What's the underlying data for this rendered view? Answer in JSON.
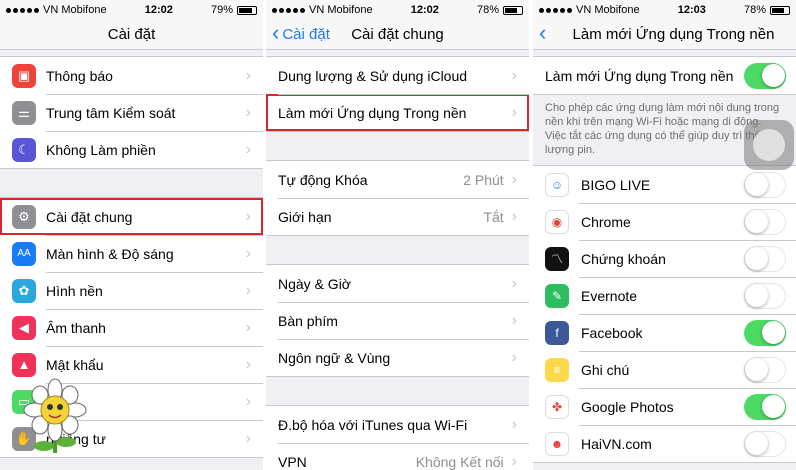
{
  "panels": [
    {
      "status": {
        "carrier": "VN Mobifone",
        "time": "12:02",
        "battery": "79%",
        "battery_level": 0.79
      },
      "nav": {
        "title": "Cài đặt"
      },
      "groups": [
        [
          {
            "label": "Thông báo",
            "icon": "notification-icon",
            "color": "#f0443a"
          },
          {
            "label": "Trung tâm Kiểm soát",
            "icon": "control-center-icon",
            "color": "#8e8e93"
          },
          {
            "label": "Không Làm phiền",
            "icon": "moon-icon",
            "color": "#5856d6"
          }
        ],
        [
          {
            "label": "Cài đặt chung",
            "icon": "gear-icon",
            "color": "#8e8e93"
          },
          {
            "label": "Màn hình & Độ sáng",
            "icon": "display-icon",
            "color": "#1a7cf5"
          },
          {
            "label": "Hình nền",
            "icon": "wallpaper-icon",
            "color": "#2aa7dc"
          },
          {
            "label": "Âm thanh",
            "icon": "sound-icon",
            "color": "#f0325a"
          },
          {
            "label": "Mật khẩu",
            "icon": "lock-icon",
            "color": "#f0325a"
          },
          {
            "label": "",
            "icon": "battery-icon",
            "color": "#4cd964"
          },
          {
            "label": "n riêng tư",
            "icon": "privacy-icon",
            "color": "#8e8e93"
          }
        ]
      ]
    },
    {
      "status": {
        "carrier": "VN Mobifone",
        "time": "12:02",
        "battery": "78%",
        "battery_level": 0.78
      },
      "nav": {
        "back": "Cài đặt",
        "title": "Cài đặt chung"
      },
      "groups": [
        [
          {
            "label": "Dung lượng & Sử dụng iCloud",
            "value": ""
          },
          {
            "label": "Làm mới Ứng dụng Trong nền",
            "value": ""
          }
        ],
        [
          {
            "label": "Tự động Khóa",
            "value": "2 Phút"
          },
          {
            "label": "Giới hạn",
            "value": "Tắt"
          }
        ],
        [
          {
            "label": "Ngày & Giờ",
            "value": ""
          },
          {
            "label": "Bàn phím",
            "value": ""
          },
          {
            "label": "Ngôn ngữ & Vùng",
            "value": ""
          }
        ],
        [
          {
            "label": "Đ.bộ hóa với iTunes qua Wi-Fi",
            "value": ""
          },
          {
            "label": "VPN",
            "value": "Không Kết nối"
          }
        ]
      ]
    },
    {
      "status": {
        "carrier": "VN Mobifone",
        "time": "12:03",
        "battery": "78%",
        "battery_level": 0.78
      },
      "nav": {
        "title": "Làm mới Ứng dụng Trong nền"
      },
      "master": {
        "label": "Làm mới Ứng dụng Trong nền",
        "on": true
      },
      "footer": "Cho phép các ứng dụng làm mới nội dung trong nền khi trên mạng Wi-Fi hoặc mạng di động. Việc tắt các ứng dụng có thể giúp duy trì thời lượng pin.",
      "apps": [
        {
          "label": "BIGO LIVE",
          "on": false,
          "icon": "bigo-live-icon",
          "color": "#ffffff",
          "glyph": "☺",
          "fg": "#1a8fd6"
        },
        {
          "label": "Chrome",
          "on": false,
          "icon": "chrome-icon",
          "color": "#ffffff",
          "glyph": "◉",
          "fg": "#db4437"
        },
        {
          "label": "Chứng khoán",
          "on": false,
          "icon": "stocks-icon",
          "color": "#111111",
          "glyph": "〽",
          "fg": "#ffffff"
        },
        {
          "label": "Evernote",
          "on": false,
          "icon": "evernote-icon",
          "color": "#2dbe60",
          "glyph": "✎",
          "fg": "#ffffff"
        },
        {
          "label": "Facebook",
          "on": true,
          "icon": "facebook-icon",
          "color": "#3b5998",
          "glyph": "f",
          "fg": "#ffffff"
        },
        {
          "label": "Ghi chú",
          "on": false,
          "icon": "notes-icon",
          "color": "#fcd84b",
          "glyph": "≡",
          "fg": "#ffffff"
        },
        {
          "label": "Google Photos",
          "on": true,
          "icon": "google-photos-icon",
          "color": "#ffffff",
          "glyph": "✤",
          "fg": "#ea4335"
        },
        {
          "label": "HaiVN.com",
          "on": false,
          "icon": "haivn-icon",
          "color": "#ffffff",
          "glyph": "☻",
          "fg": "#e53935"
        }
      ]
    }
  ],
  "icons": {
    "chevron": "›",
    "back_chevron": "‹"
  }
}
